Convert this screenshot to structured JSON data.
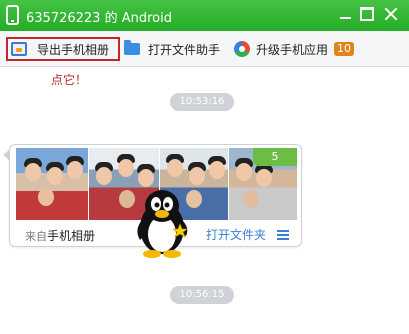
{
  "window": {
    "title": "635726223 的 Android"
  },
  "toolbar": {
    "export_label": "导出手机相册",
    "helper_label": "打开文件助手",
    "upgrade_label": "升级手机应用",
    "upgrade_badge": "10"
  },
  "chat": {
    "hint": "点它！",
    "time1": "10:53:16",
    "time2": "10:56:15",
    "album": {
      "photo_count": "5",
      "source_prefix": "来自",
      "source_name": "手机相册",
      "open_folder": "打开文件夹"
    }
  },
  "colors": {
    "titlebar": "#2eb82e",
    "highlight_border": "#c0262c",
    "badge": "#e0841c",
    "link": "#3b7fd4",
    "count_badge": "#6cbd45"
  },
  "icons": {
    "title": "phone-icon",
    "export": "export-photo-icon",
    "helper": "folder-icon",
    "upgrade": "upgrade-app-icon",
    "menu": "menu-icon",
    "mascot": "qq-penguin-icon"
  }
}
